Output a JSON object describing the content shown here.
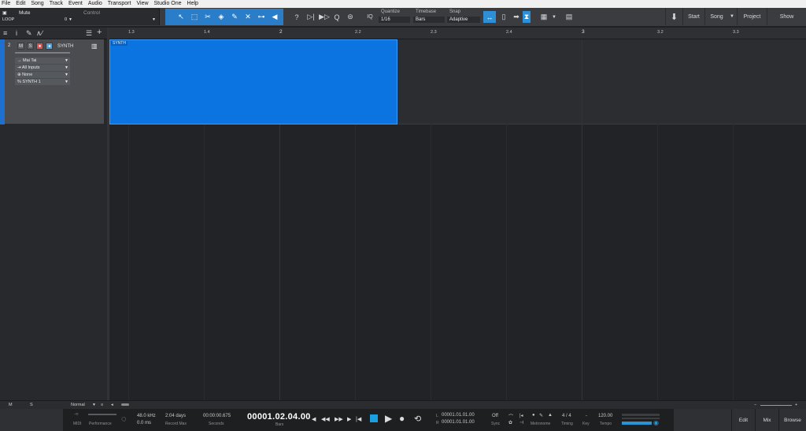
{
  "menubar": [
    "File",
    "Edit",
    "Song",
    "Track",
    "Event",
    "Audio",
    "Transport",
    "View",
    "Studio One",
    "Help"
  ],
  "toolbar": {
    "context": {
      "name": "Mute",
      "type": "LOOP",
      "value": "0",
      "control_label": "Control"
    },
    "quantize": {
      "label": "Quantize",
      "value": "1/16",
      "iq": "IQ"
    },
    "timebase": {
      "label": "Timebase",
      "value": "Bars"
    },
    "snap": {
      "label": "Snap",
      "value": "Adaptive"
    },
    "nav": {
      "start": "Start",
      "song": "Song",
      "project": "Project",
      "show": "Show"
    },
    "help_glyph": "?"
  },
  "track": {
    "number": "2",
    "mute": "M",
    "solo": "S",
    "name": "SYNTH",
    "routing": [
      {
        "icon": "→",
        "label": "Mai Tai"
      },
      {
        "icon": "⇥",
        "label": "All Inputs"
      },
      {
        "icon": "⊕",
        "label": "None"
      },
      {
        "icon": "%",
        "label": "SYNTH 1"
      }
    ]
  },
  "ruler": {
    "marks": [
      {
        "label": "1.3",
        "big": false
      },
      {
        "label": "1.4",
        "big": false
      },
      {
        "label": "2",
        "big": true
      },
      {
        "label": "2.2",
        "big": false
      },
      {
        "label": "2.3",
        "big": false
      },
      {
        "label": "2.4",
        "big": false
      },
      {
        "label": "3",
        "big": true
      },
      {
        "label": "3.2",
        "big": false
      },
      {
        "label": "3.3",
        "big": false
      }
    ]
  },
  "event": {
    "name": "SYNTH"
  },
  "bottom": {
    "m": "M",
    "s": "S",
    "zoom_mode": "Normal"
  },
  "transport": {
    "midi_label": "MIDI",
    "performance_label": "Performance",
    "sample_rate": "48.0 kHz",
    "latency": "0.0 ms",
    "record_max_value": "2:04 days",
    "record_max_label": "Record Max",
    "seconds_value": "00:00:00.675",
    "seconds_label": "Seconds",
    "position": "00001.02.04.00",
    "position_unit": "Bars",
    "loop_left_tag": "L",
    "loop_left": "00001.01.01.00",
    "loop_right_tag": "R",
    "loop_right": "00001.01.01.00",
    "sync_value": "Off",
    "sync_label": "Sync",
    "metronome_label": "Metronome",
    "timing_value": "4 / 4",
    "timing_label": "Timing",
    "key_value": "-",
    "key_label": "Key",
    "tempo_value": "120.00",
    "tempo_label": "Tempo"
  },
  "panels": {
    "edit": "Edit",
    "mix": "Mix",
    "browse": "Browse"
  }
}
